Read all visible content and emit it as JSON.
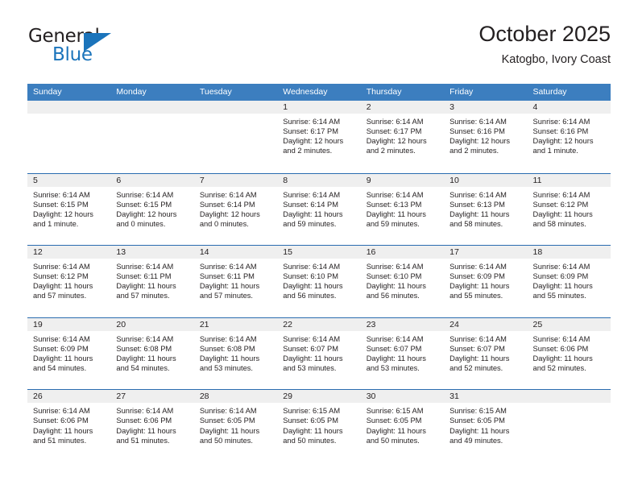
{
  "logo": {
    "text_top": "General",
    "text_bottom": "Blue",
    "accent_color": "#1b74bb",
    "triangle_icon": "triangle-icon"
  },
  "header": {
    "title": "October 2025",
    "subtitle": "Katogbo, Ivory Coast"
  },
  "calendar": {
    "header_color": "#3c7ebf",
    "band_color": "#efefef",
    "weekdays": [
      "Sunday",
      "Monday",
      "Tuesday",
      "Wednesday",
      "Thursday",
      "Friday",
      "Saturday"
    ],
    "weeks": [
      [
        {
          "date": "",
          "sunrise": "",
          "sunset": "",
          "daylight": ""
        },
        {
          "date": "",
          "sunrise": "",
          "sunset": "",
          "daylight": ""
        },
        {
          "date": "",
          "sunrise": "",
          "sunset": "",
          "daylight": ""
        },
        {
          "date": "1",
          "sunrise": "Sunrise: 6:14 AM",
          "sunset": "Sunset: 6:17 PM",
          "daylight": "Daylight: 12 hours and 2 minutes."
        },
        {
          "date": "2",
          "sunrise": "Sunrise: 6:14 AM",
          "sunset": "Sunset: 6:17 PM",
          "daylight": "Daylight: 12 hours and 2 minutes."
        },
        {
          "date": "3",
          "sunrise": "Sunrise: 6:14 AM",
          "sunset": "Sunset: 6:16 PM",
          "daylight": "Daylight: 12 hours and 2 minutes."
        },
        {
          "date": "4",
          "sunrise": "Sunrise: 6:14 AM",
          "sunset": "Sunset: 6:16 PM",
          "daylight": "Daylight: 12 hours and 1 minute."
        }
      ],
      [
        {
          "date": "5",
          "sunrise": "Sunrise: 6:14 AM",
          "sunset": "Sunset: 6:15 PM",
          "daylight": "Daylight: 12 hours and 1 minute."
        },
        {
          "date": "6",
          "sunrise": "Sunrise: 6:14 AM",
          "sunset": "Sunset: 6:15 PM",
          "daylight": "Daylight: 12 hours and 0 minutes."
        },
        {
          "date": "7",
          "sunrise": "Sunrise: 6:14 AM",
          "sunset": "Sunset: 6:14 PM",
          "daylight": "Daylight: 12 hours and 0 minutes."
        },
        {
          "date": "8",
          "sunrise": "Sunrise: 6:14 AM",
          "sunset": "Sunset: 6:14 PM",
          "daylight": "Daylight: 11 hours and 59 minutes."
        },
        {
          "date": "9",
          "sunrise": "Sunrise: 6:14 AM",
          "sunset": "Sunset: 6:13 PM",
          "daylight": "Daylight: 11 hours and 59 minutes."
        },
        {
          "date": "10",
          "sunrise": "Sunrise: 6:14 AM",
          "sunset": "Sunset: 6:13 PM",
          "daylight": "Daylight: 11 hours and 58 minutes."
        },
        {
          "date": "11",
          "sunrise": "Sunrise: 6:14 AM",
          "sunset": "Sunset: 6:12 PM",
          "daylight": "Daylight: 11 hours and 58 minutes."
        }
      ],
      [
        {
          "date": "12",
          "sunrise": "Sunrise: 6:14 AM",
          "sunset": "Sunset: 6:12 PM",
          "daylight": "Daylight: 11 hours and 57 minutes."
        },
        {
          "date": "13",
          "sunrise": "Sunrise: 6:14 AM",
          "sunset": "Sunset: 6:11 PM",
          "daylight": "Daylight: 11 hours and 57 minutes."
        },
        {
          "date": "14",
          "sunrise": "Sunrise: 6:14 AM",
          "sunset": "Sunset: 6:11 PM",
          "daylight": "Daylight: 11 hours and 57 minutes."
        },
        {
          "date": "15",
          "sunrise": "Sunrise: 6:14 AM",
          "sunset": "Sunset: 6:10 PM",
          "daylight": "Daylight: 11 hours and 56 minutes."
        },
        {
          "date": "16",
          "sunrise": "Sunrise: 6:14 AM",
          "sunset": "Sunset: 6:10 PM",
          "daylight": "Daylight: 11 hours and 56 minutes."
        },
        {
          "date": "17",
          "sunrise": "Sunrise: 6:14 AM",
          "sunset": "Sunset: 6:09 PM",
          "daylight": "Daylight: 11 hours and 55 minutes."
        },
        {
          "date": "18",
          "sunrise": "Sunrise: 6:14 AM",
          "sunset": "Sunset: 6:09 PM",
          "daylight": "Daylight: 11 hours and 55 minutes."
        }
      ],
      [
        {
          "date": "19",
          "sunrise": "Sunrise: 6:14 AM",
          "sunset": "Sunset: 6:09 PM",
          "daylight": "Daylight: 11 hours and 54 minutes."
        },
        {
          "date": "20",
          "sunrise": "Sunrise: 6:14 AM",
          "sunset": "Sunset: 6:08 PM",
          "daylight": "Daylight: 11 hours and 54 minutes."
        },
        {
          "date": "21",
          "sunrise": "Sunrise: 6:14 AM",
          "sunset": "Sunset: 6:08 PM",
          "daylight": "Daylight: 11 hours and 53 minutes."
        },
        {
          "date": "22",
          "sunrise": "Sunrise: 6:14 AM",
          "sunset": "Sunset: 6:07 PM",
          "daylight": "Daylight: 11 hours and 53 minutes."
        },
        {
          "date": "23",
          "sunrise": "Sunrise: 6:14 AM",
          "sunset": "Sunset: 6:07 PM",
          "daylight": "Daylight: 11 hours and 53 minutes."
        },
        {
          "date": "24",
          "sunrise": "Sunrise: 6:14 AM",
          "sunset": "Sunset: 6:07 PM",
          "daylight": "Daylight: 11 hours and 52 minutes."
        },
        {
          "date": "25",
          "sunrise": "Sunrise: 6:14 AM",
          "sunset": "Sunset: 6:06 PM",
          "daylight": "Daylight: 11 hours and 52 minutes."
        }
      ],
      [
        {
          "date": "26",
          "sunrise": "Sunrise: 6:14 AM",
          "sunset": "Sunset: 6:06 PM",
          "daylight": "Daylight: 11 hours and 51 minutes."
        },
        {
          "date": "27",
          "sunrise": "Sunrise: 6:14 AM",
          "sunset": "Sunset: 6:06 PM",
          "daylight": "Daylight: 11 hours and 51 minutes."
        },
        {
          "date": "28",
          "sunrise": "Sunrise: 6:14 AM",
          "sunset": "Sunset: 6:05 PM",
          "daylight": "Daylight: 11 hours and 50 minutes."
        },
        {
          "date": "29",
          "sunrise": "Sunrise: 6:15 AM",
          "sunset": "Sunset: 6:05 PM",
          "daylight": "Daylight: 11 hours and 50 minutes."
        },
        {
          "date": "30",
          "sunrise": "Sunrise: 6:15 AM",
          "sunset": "Sunset: 6:05 PM",
          "daylight": "Daylight: 11 hours and 50 minutes."
        },
        {
          "date": "31",
          "sunrise": "Sunrise: 6:15 AM",
          "sunset": "Sunset: 6:05 PM",
          "daylight": "Daylight: 11 hours and 49 minutes."
        },
        {
          "date": "",
          "sunrise": "",
          "sunset": "",
          "daylight": ""
        }
      ]
    ]
  }
}
